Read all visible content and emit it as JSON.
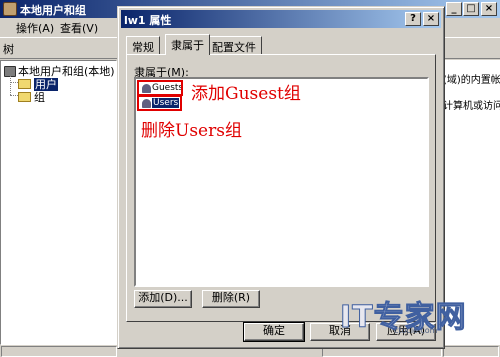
{
  "mmc": {
    "title": "本地用户和组",
    "menu": [
      "操作(A)",
      "查看(V)"
    ],
    "toolbar_tab": "树",
    "tree": {
      "root": "本地用户和组(本地)",
      "users": "用户",
      "groups": "组"
    },
    "right_lines": [
      "(域)的内置帐",
      "计算机或访问"
    ]
  },
  "dialog": {
    "title": "lw1 属性",
    "help_btn": "?",
    "close_btn": "×",
    "tabs": [
      "常规",
      "隶属于",
      "配置文件"
    ],
    "active_tab": "隶属于",
    "members_label": "隶属于(M):",
    "members": [
      {
        "name": "Guests",
        "selected": false
      },
      {
        "name": "Users",
        "selected": true
      }
    ],
    "add_btn": "添加(D)...",
    "remove_btn": "删除(R)",
    "ok_btn": "确定",
    "cancel_btn": "取消",
    "apply_btn": "应用(A)"
  },
  "annotations": {
    "add": "添加Gusest组",
    "remove": "删除Users组",
    "color": "#e00000"
  },
  "watermark": {
    "text": "IT专家网",
    "sub": "ctocio.com"
  }
}
